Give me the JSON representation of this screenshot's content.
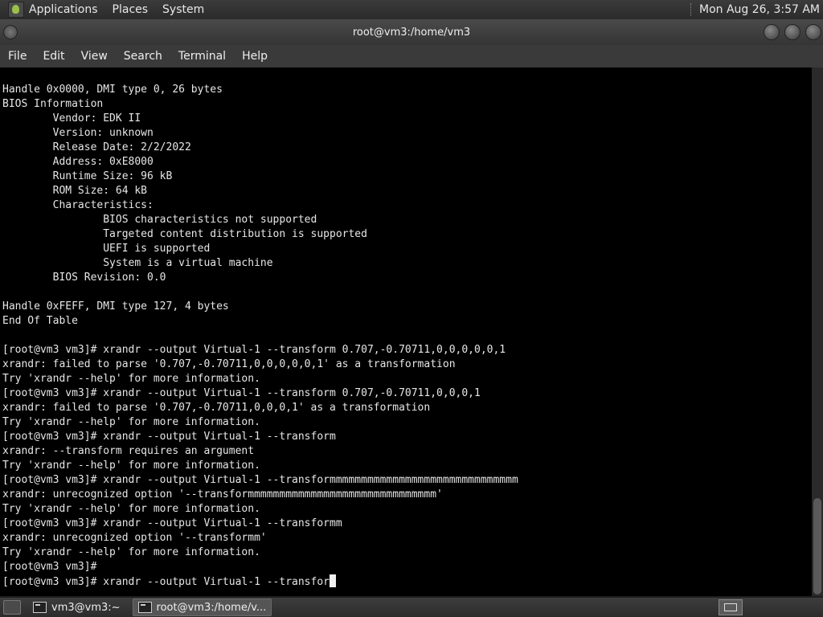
{
  "top_panel": {
    "menus": [
      "Applications",
      "Places",
      "System"
    ],
    "clock": "Mon Aug 26,  3:57 AM"
  },
  "window": {
    "title": "root@vm3:/home/vm3",
    "menu": [
      "File",
      "Edit",
      "View",
      "Search",
      "Terminal",
      "Help"
    ]
  },
  "terminal": {
    "lines": [
      "Handle 0x0000, DMI type 0, 26 bytes",
      "BIOS Information",
      "        Vendor: EDK II",
      "        Version: unknown",
      "        Release Date: 2/2/2022",
      "        Address: 0xE8000",
      "        Runtime Size: 96 kB",
      "        ROM Size: 64 kB",
      "        Characteristics:",
      "                BIOS characteristics not supported",
      "                Targeted content distribution is supported",
      "                UEFI is supported",
      "                System is a virtual machine",
      "        BIOS Revision: 0.0",
      "",
      "Handle 0xFEFF, DMI type 127, 4 bytes",
      "End Of Table",
      "",
      "[root@vm3 vm3]# xrandr --output Virtual-1 --transform 0.707,-0.70711,0,0,0,0,0,1",
      "xrandr: failed to parse '0.707,-0.70711,0,0,0,0,0,1' as a transformation",
      "Try 'xrandr --help' for more information.",
      "[root@vm3 vm3]# xrandr --output Virtual-1 --transform 0.707,-0.70711,0,0,0,1",
      "xrandr: failed to parse '0.707,-0.70711,0,0,0,1' as a transformation",
      "Try 'xrandr --help' for more information.",
      "[root@vm3 vm3]# xrandr --output Virtual-1 --transform",
      "xrandr: --transform requires an argument",
      "Try 'xrandr --help' for more information.",
      "[root@vm3 vm3]# xrandr --output Virtual-1 --transformmmmmmmmmmmmmmmmmmmmmmmmmmmmmm",
      "xrandr: unrecognized option '--transformmmmmmmmmmmmmmmmmmmmmmmmmmmmmm'",
      "Try 'xrandr --help' for more information.",
      "[root@vm3 vm3]# xrandr --output Virtual-1 --transformm",
      "xrandr: unrecognized option '--transformm'",
      "Try 'xrandr --help' for more information.",
      "[root@vm3 vm3]#"
    ],
    "current_input": "[root@vm3 vm3]# xrandr --output Virtual-1 --transfor"
  },
  "taskbar": {
    "tasks": [
      {
        "label": "vm3@vm3:~"
      },
      {
        "label": "root@vm3:/home/v..."
      }
    ]
  }
}
